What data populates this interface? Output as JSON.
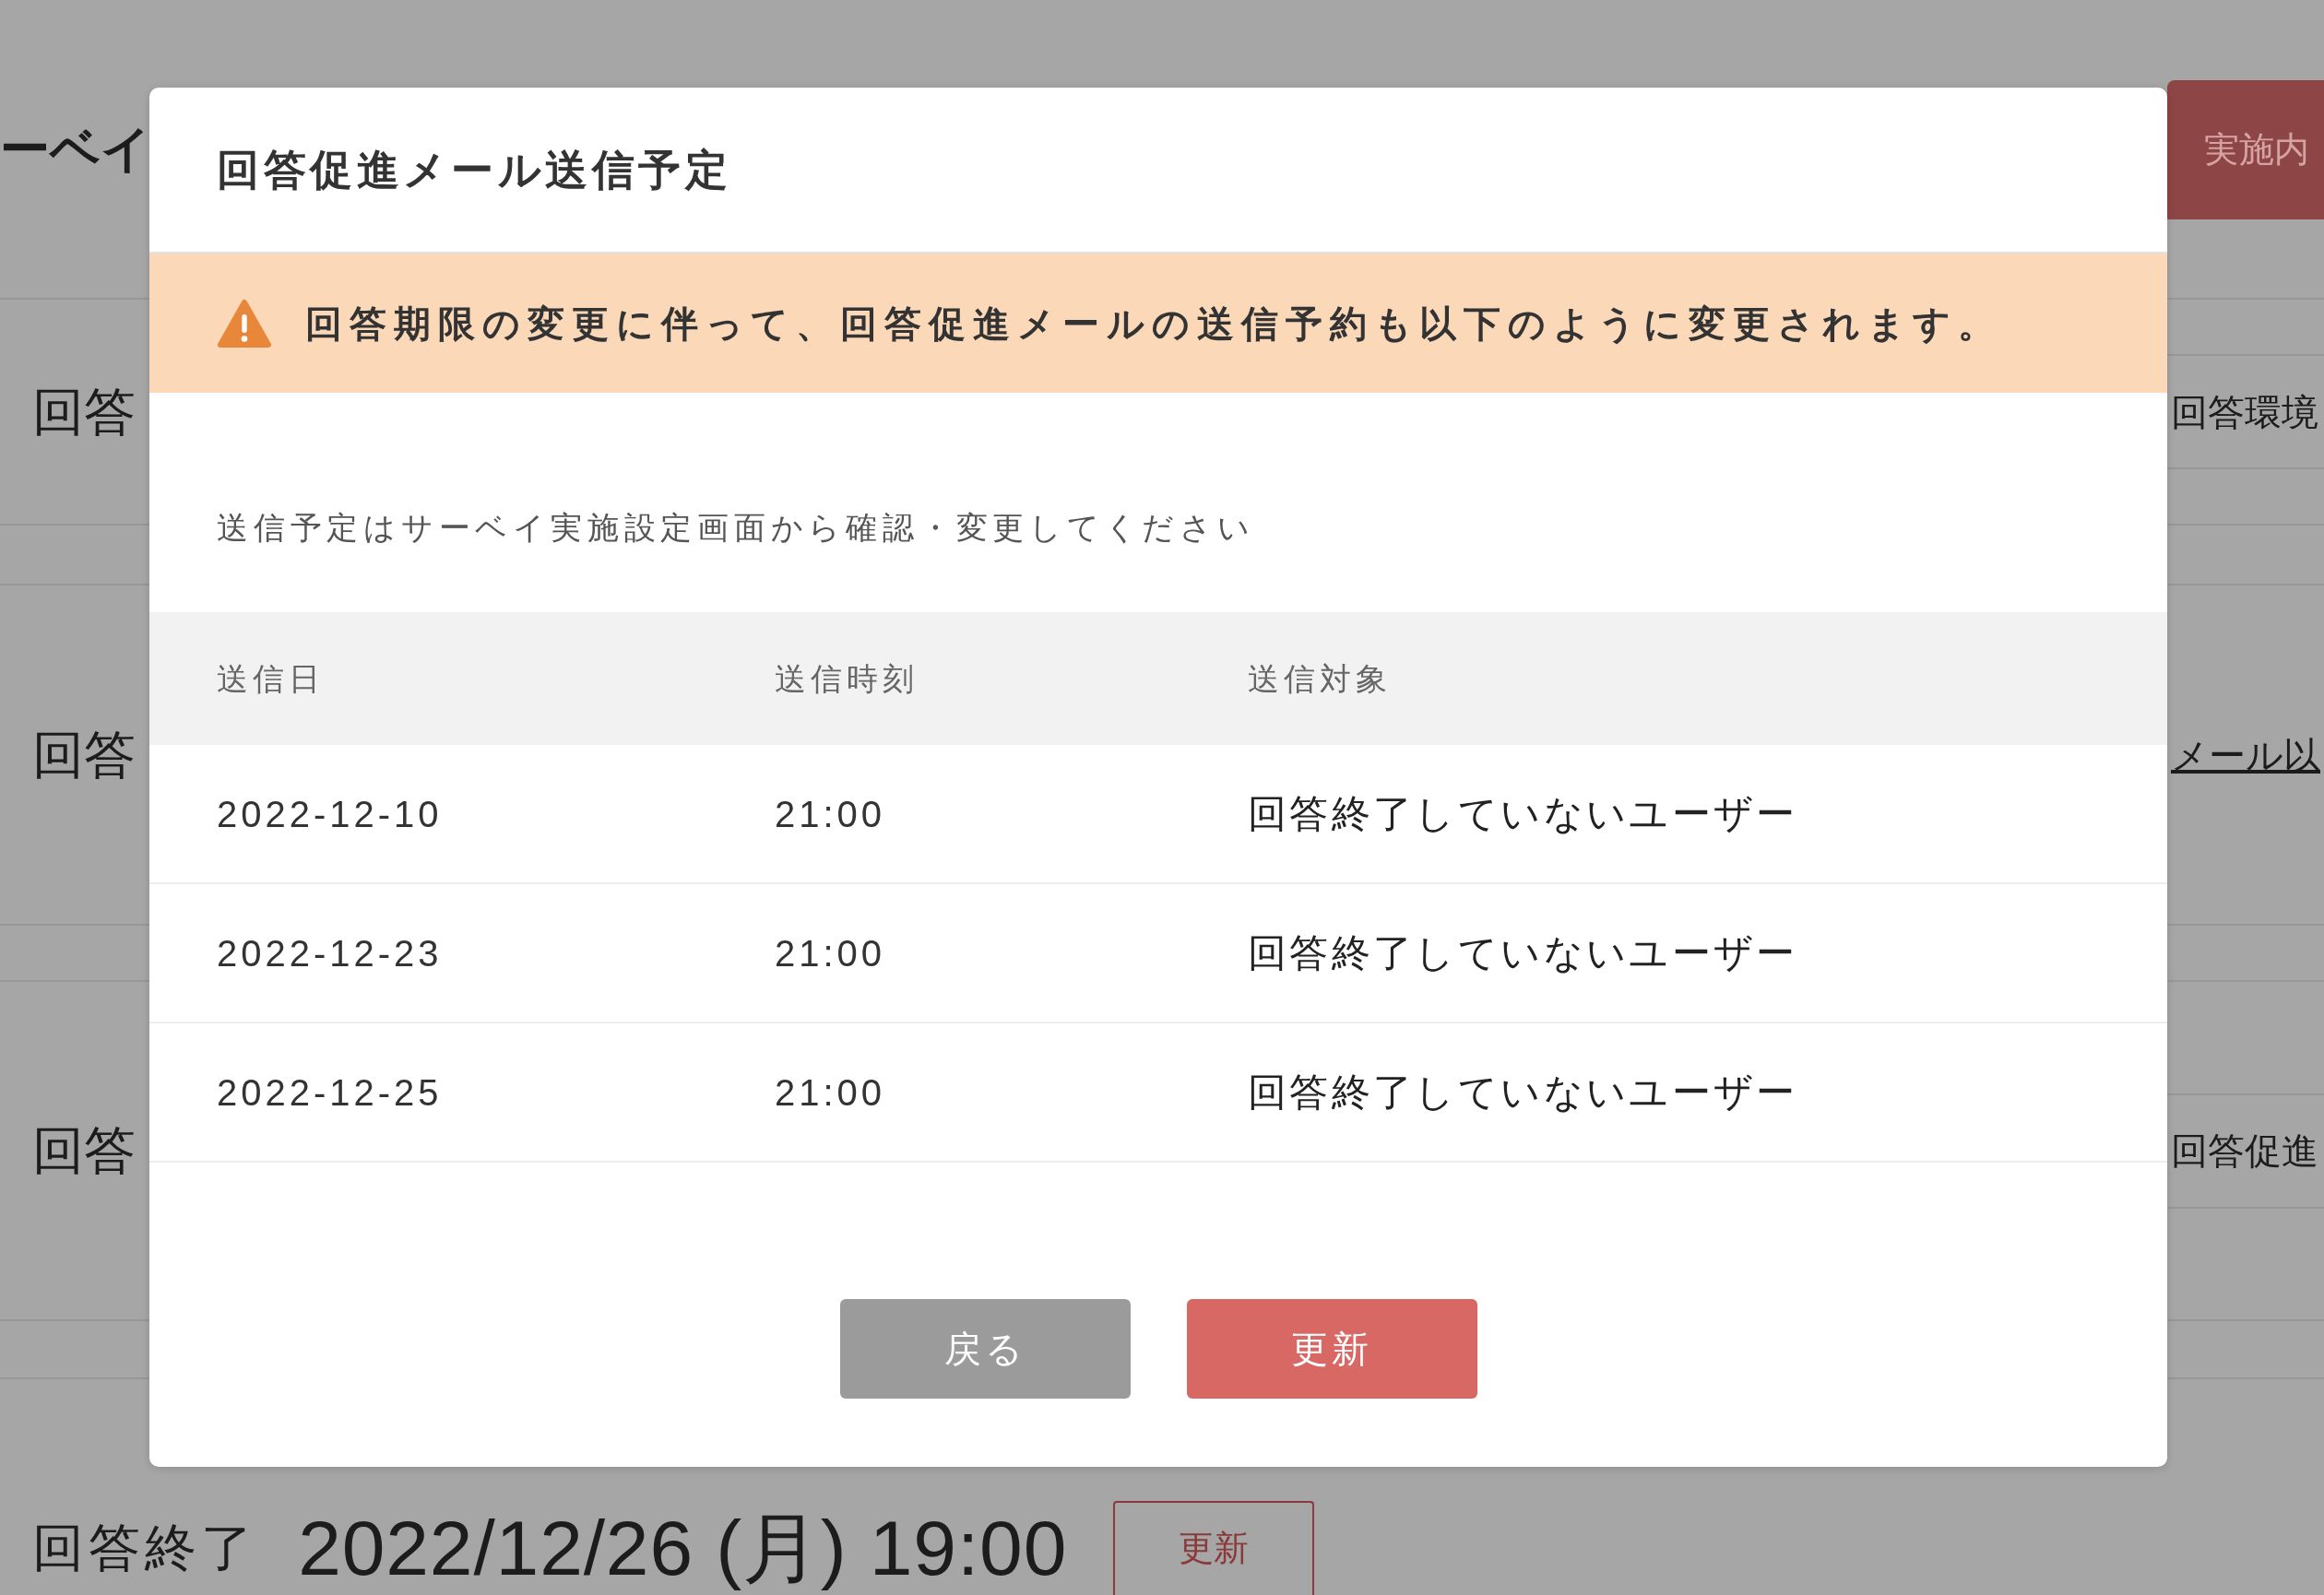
{
  "background": {
    "page_title": "ーベイ",
    "top_button": "実施内",
    "sections": [
      {
        "label": "回答",
        "side": {
          "kind": "text",
          "text": "回答環境"
        }
      },
      {
        "label": "回答",
        "side": {
          "kind": "link",
          "text": "メール以"
        }
      },
      {
        "label": "回答",
        "side": {
          "kind": "text",
          "text": "回答促進"
        }
      }
    ],
    "end_row": {
      "label": "回答終了",
      "value": "2022/12/26 (月) 19:00",
      "button": "更新"
    }
  },
  "dialog": {
    "title": "回答促進メール送信予定",
    "warning": "回答期限の変更に伴って、回答促進メールの送信予約も以下のように変更されます。",
    "note": "送信予定はサーベイ実施設定画面から確認・変更してください",
    "table": {
      "columns": [
        "送信日",
        "送信時刻",
        "送信対象"
      ],
      "rows": [
        [
          "2022-12-10",
          "21:00",
          "回答終了していないユーザー"
        ],
        [
          "2022-12-23",
          "21:00",
          "回答終了していないユーザー"
        ],
        [
          "2022-12-25",
          "21:00",
          "回答終了していないユーザー"
        ]
      ]
    },
    "buttons": [
      {
        "label": "戻る",
        "kind": "secondary"
      },
      {
        "label": "更新",
        "kind": "primary"
      }
    ]
  }
}
